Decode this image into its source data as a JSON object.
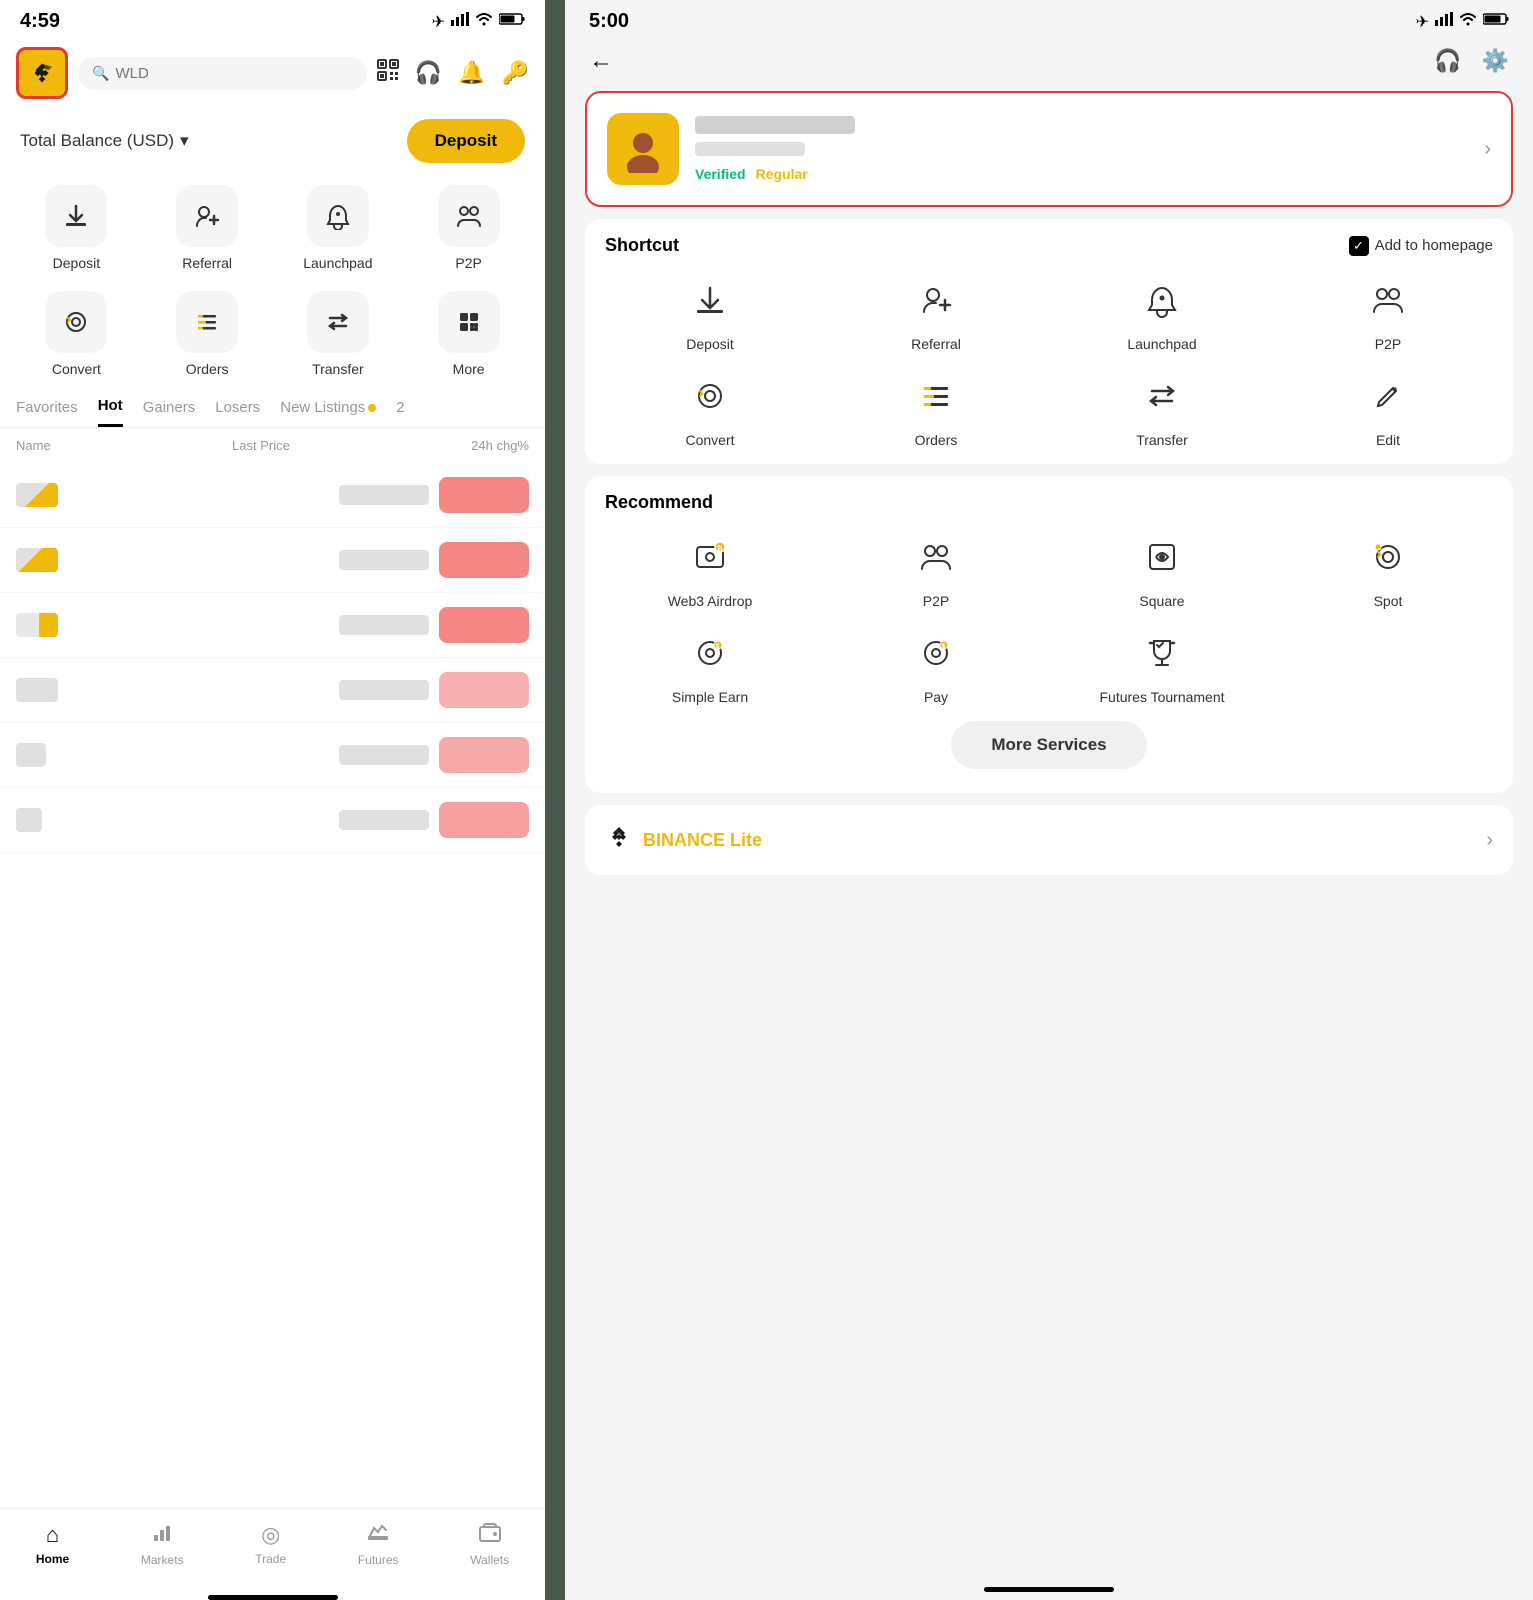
{
  "left": {
    "status": {
      "time": "4:59",
      "location_icon": "▶",
      "signal": "▐▐▐▐",
      "wifi": "wifi",
      "battery": "▬"
    },
    "search": {
      "placeholder": "WLD"
    },
    "balance_label": "Total Balance (USD)",
    "deposit_button": "Deposit",
    "quick_actions": [
      {
        "label": "Deposit",
        "icon": "⬇"
      },
      {
        "label": "Referral",
        "icon": "👤+"
      },
      {
        "label": "Launchpad",
        "icon": "🚀"
      },
      {
        "label": "P2P",
        "icon": "👥"
      }
    ],
    "quick_actions2": [
      {
        "label": "Convert",
        "icon": "◎"
      },
      {
        "label": "Orders",
        "icon": "≡"
      },
      {
        "label": "Transfer",
        "icon": "⇄"
      },
      {
        "label": "More",
        "icon": "⋯"
      }
    ],
    "tabs": [
      "Favorites",
      "Hot",
      "Gainers",
      "Losers",
      "New Listings"
    ],
    "active_tab": "Hot",
    "table_headers": {
      "name": "Name",
      "last_price": "Last Price",
      "change": "24h chg%"
    },
    "bottom_nav": [
      {
        "label": "Home",
        "active": true
      },
      {
        "label": "Markets",
        "active": false
      },
      {
        "label": "Trade",
        "active": false
      },
      {
        "label": "Futures",
        "active": false
      },
      {
        "label": "Wallets",
        "active": false
      }
    ]
  },
  "right": {
    "status": {
      "time": "5:00",
      "location_icon": "▶"
    },
    "back_label": "←",
    "profile": {
      "verified_label": "Verified",
      "regular_label": "Regular",
      "chevron": "›"
    },
    "shortcut": {
      "title": "Shortcut",
      "add_homepage_label": "Add to homepage",
      "actions": [
        {
          "label": "Deposit",
          "icon": "⬇"
        },
        {
          "label": "Referral",
          "icon": "👤"
        },
        {
          "label": "Launchpad",
          "icon": "🚀"
        },
        {
          "label": "P2P",
          "icon": "👥"
        },
        {
          "label": "Convert",
          "icon": "◎"
        },
        {
          "label": "Orders",
          "icon": "≡"
        },
        {
          "label": "Transfer",
          "icon": "⇄"
        },
        {
          "label": "Edit",
          "icon": "✎"
        }
      ]
    },
    "recommend": {
      "title": "Recommend",
      "actions": [
        {
          "label": "Web3 Airdrop",
          "icon": "🎁"
        },
        {
          "label": "P2P",
          "icon": "👥"
        },
        {
          "label": "Square",
          "icon": "📡"
        },
        {
          "label": "Spot",
          "icon": "◎"
        },
        {
          "label": "Simple Earn",
          "icon": "🔐"
        },
        {
          "label": "Pay",
          "icon": "💰"
        },
        {
          "label": "Futures Tournament",
          "icon": "👑"
        }
      ]
    },
    "more_services_label": "More Services",
    "lite_banner": {
      "logo": "◆",
      "text_black": "BINANCE",
      "text_yellow": " Lite",
      "chevron": "›"
    }
  }
}
